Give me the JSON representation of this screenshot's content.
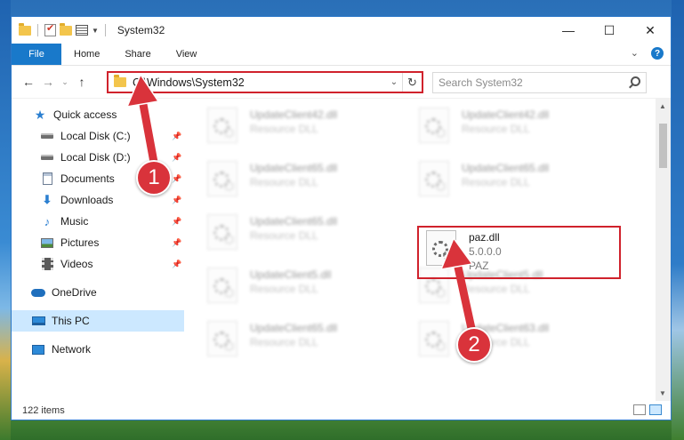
{
  "window": {
    "title": "System32"
  },
  "ribbon": {
    "tabs": [
      "File",
      "Home",
      "Share",
      "View"
    ]
  },
  "address": {
    "path": "C:\\Windows\\System32"
  },
  "search": {
    "placeholder": "Search System32"
  },
  "nav": {
    "quick_access": "Quick access",
    "items": [
      {
        "label": "Local Disk (C:)",
        "icon": "disk-icon"
      },
      {
        "label": "Local Disk (D:)",
        "icon": "disk-icon"
      },
      {
        "label": "Documents",
        "icon": "documents-icon"
      },
      {
        "label": "Downloads",
        "icon": "downloads-icon"
      },
      {
        "label": "Music",
        "icon": "music-icon"
      },
      {
        "label": "Pictures",
        "icon": "pictures-icon"
      },
      {
        "label": "Videos",
        "icon": "videos-icon"
      }
    ],
    "onedrive": "OneDrive",
    "this_pc": "This PC",
    "network": "Network"
  },
  "files": [
    {
      "name": "UpdateClient42.dll",
      "sub": "Resource DLL"
    },
    {
      "name": "UpdateClient42.dll",
      "sub": "Resource DLL"
    },
    {
      "name": "UpdateClient65.dll",
      "sub": "Resource DLL"
    },
    {
      "name": "UpdateClient65.dll",
      "sub": "Resource DLL"
    },
    {
      "name": "UpdateClient65.dll",
      "sub": "Resource DLL"
    },
    {
      "name": "UpdateClient5.dll",
      "sub": "Resource DLL"
    },
    {
      "name": "UpdateClient5.dll",
      "sub": "Resource DLL"
    },
    {
      "name": "UpdateClient65.dll",
      "sub": "Resource DLL"
    },
    {
      "name": "UpdateClient63.dll",
      "sub": "Resource DLL"
    }
  ],
  "selected_file": {
    "name": "paz.dll",
    "version": "5.0.0.0",
    "company": "PAZ"
  },
  "status": {
    "item_count": "122 items"
  },
  "callouts": {
    "one": "1",
    "two": "2"
  },
  "colors": {
    "accent": "#1979ca",
    "highlight": "#d0222c"
  }
}
